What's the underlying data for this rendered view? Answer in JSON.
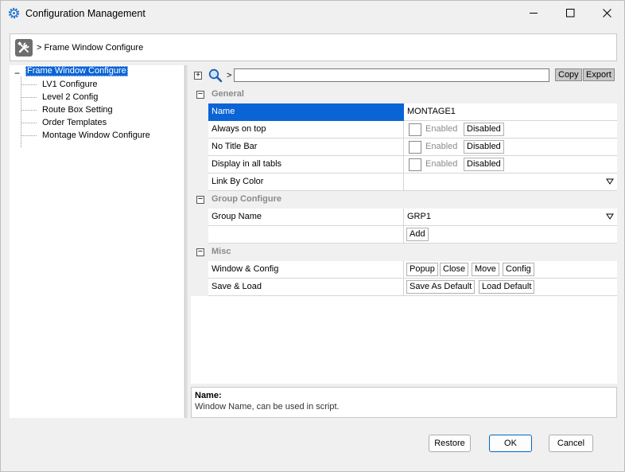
{
  "window": {
    "title": "Configuration Management",
    "controls": {
      "minimize": "minimize",
      "maximize": "maximize",
      "close": "close"
    }
  },
  "breadcrumb": {
    "icon": "tools-icon",
    "text": "> Frame Window Configure"
  },
  "tree": {
    "root": "Frame Window Configure",
    "collapse_symbol": "−",
    "children": [
      "LV1 Configure",
      "Level 2 Config",
      "Route Box Setting",
      "Order Templates",
      "Montage Window Configure"
    ]
  },
  "toolbar": {
    "expand_symbol": "+",
    "path_sep": ">",
    "search_value": "",
    "copy_label": "Copy",
    "export_label": "Export"
  },
  "sections": {
    "general": {
      "label": "General",
      "rows": {
        "name": {
          "label": "Name",
          "value": "MONTAGE1"
        },
        "always_on_top": {
          "label": "Always on top",
          "enabled": "Enabled",
          "disabled": "Disabled"
        },
        "no_title_bar": {
          "label": "No Title Bar",
          "enabled": "Enabled",
          "disabled": "Disabled"
        },
        "display_all": {
          "label": "Display in all tabls",
          "enabled": "Enabled",
          "disabled": "Disabled"
        },
        "link_by_color": {
          "label": "Link By Color",
          "value": ""
        }
      }
    },
    "group": {
      "label": "Group Configure",
      "rows": {
        "group_name": {
          "label": "Group Name",
          "value": "GRP1"
        },
        "add": {
          "label": "",
          "button": "Add"
        }
      }
    },
    "misc": {
      "label": "Misc",
      "rows": {
        "window_config": {
          "label": "Window & Config",
          "buttons": [
            "Popup",
            "Close",
            "Move",
            "Config"
          ]
        },
        "save_load": {
          "label": "Save & Load",
          "buttons": [
            "Save As Default",
            "Load Default"
          ]
        }
      }
    }
  },
  "toggle_symbol": "−",
  "help": {
    "title": "Name:",
    "description": "Window Name, can be used in script."
  },
  "dialog_buttons": {
    "restore": "Restore",
    "ok": "OK",
    "cancel": "Cancel"
  },
  "colors": {
    "selection": "#0a64d6",
    "section_text": "#8a8a8a"
  }
}
